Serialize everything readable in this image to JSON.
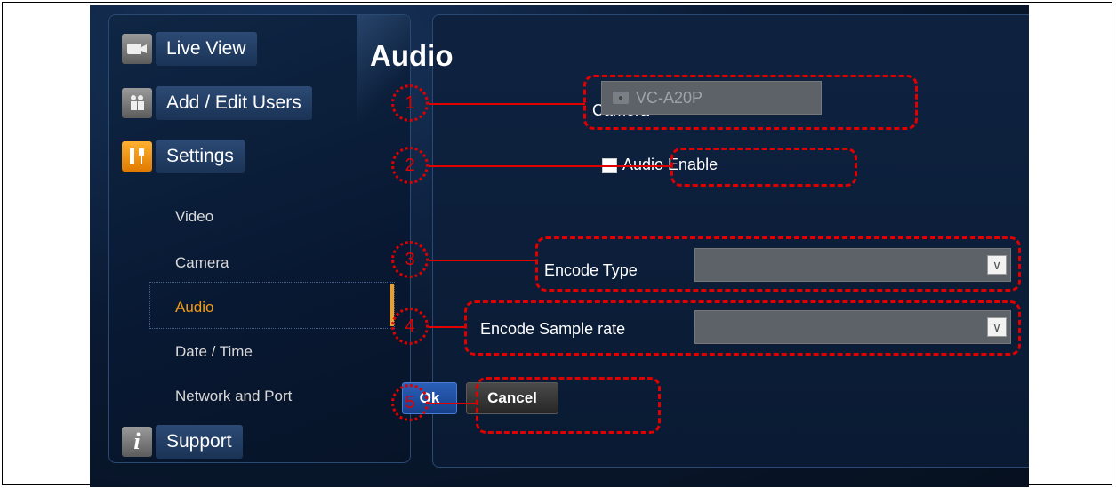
{
  "sidebar": {
    "nav": [
      {
        "label": "Live View",
        "icon": "camera-icon"
      },
      {
        "label": "Add / Edit Users",
        "icon": "users-icon"
      },
      {
        "label": "Settings",
        "icon": "settings-tools-icon"
      },
      {
        "label": "Support",
        "icon": "info-icon"
      }
    ],
    "submenu": [
      "Video",
      "Camera",
      "Audio",
      "Date / Time",
      "Network and Port"
    ],
    "active_submenu": "Audio"
  },
  "main": {
    "title": "Audio",
    "camera_label": "Camera",
    "camera_value": "VC-A20P",
    "audio_enable_label": "Audio Enable",
    "encode_type_label": "Encode Type",
    "encode_sample_rate_label": "Encode Sample rate",
    "ok_label": "Ok",
    "cancel_label": "Cancel"
  },
  "callouts": [
    "1",
    "2",
    "3",
    "4",
    "5"
  ],
  "colors": {
    "accent": "#f39c12",
    "callout": "#e00000",
    "ok_button": "#1f4fa0"
  }
}
